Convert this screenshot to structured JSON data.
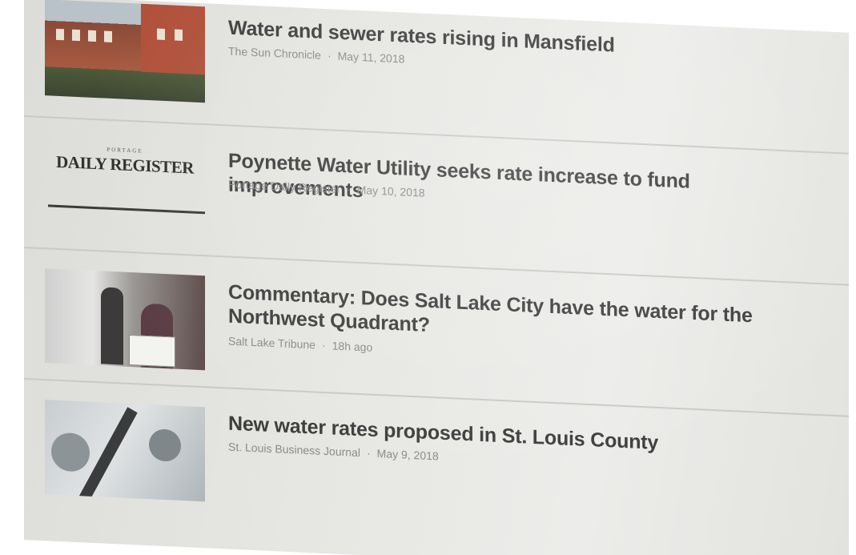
{
  "articles": [
    {
      "headline": "Water and sewer rates rising in Mansfield",
      "source": "The Sun Chronicle",
      "separator": "·",
      "date": "May 11, 2018",
      "thumbnail": "building-photo"
    },
    {
      "headline": "Poynette Water Utility seeks rate increase to fund improvements",
      "source": "Portage Daily Register",
      "separator": "·",
      "date": "May 10, 2018",
      "thumbnail": "newspaper-logo",
      "logo_small": "PORTAGE",
      "logo_main": "DAILY REGISTER"
    },
    {
      "headline": "Commentary: Does Salt Lake City have the water for the Northwest Quadrant?",
      "source": "Salt Lake Tribune",
      "separator": "·",
      "date": "18h ago",
      "thumbnail": "podium-photo"
    },
    {
      "headline": "New water rates proposed in St. Louis County",
      "source": "St. Louis Business Journal",
      "separator": "·",
      "date": "May 9, 2018",
      "thumbnail": "pipe-photo"
    }
  ],
  "colors": {
    "headline": "#3d3d3d",
    "meta": "#8a8a8a",
    "divider": "#c9c9c5"
  }
}
